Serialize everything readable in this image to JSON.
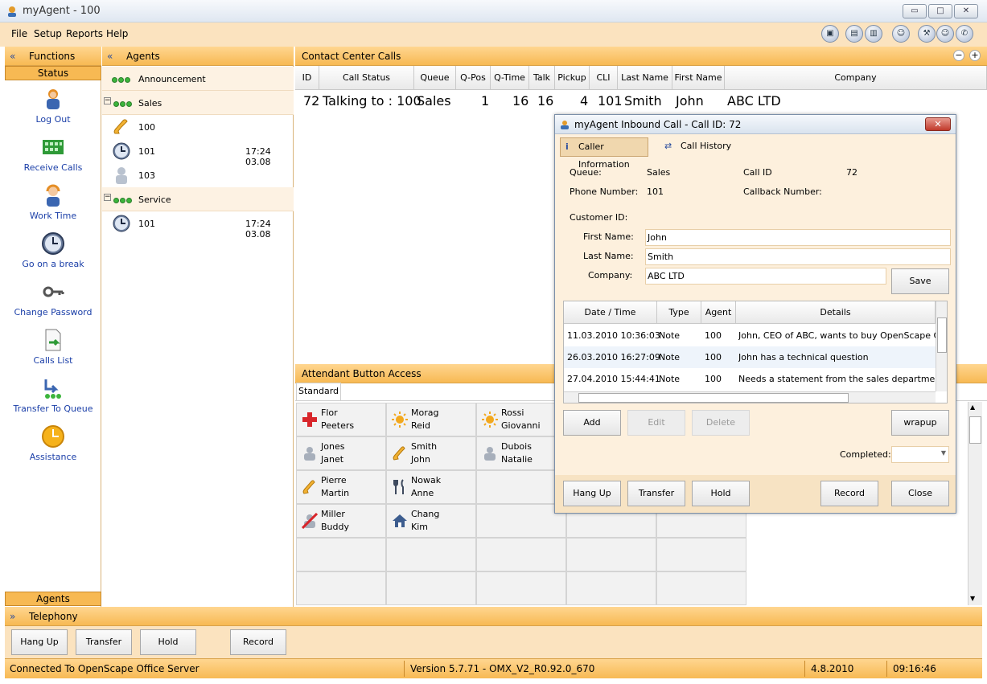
{
  "window": {
    "title": "myAgent - 100",
    "min": "▭",
    "max": "□",
    "close": "✕"
  },
  "menu": [
    "File",
    "Setup",
    "Reports",
    "Help"
  ],
  "functions": {
    "header": "Functions",
    "status_tab": "Status",
    "agents_tab": "Agents",
    "items": [
      "Log Out",
      "Receive Calls",
      "Work Time",
      "Go on a break",
      "Change Password",
      "Calls List",
      "Transfer To Queue",
      "Assistance"
    ]
  },
  "agents": {
    "header": "Agents",
    "announcement": "Announcement",
    "sales": {
      "label": "Sales",
      "rows": [
        {
          "id": "100",
          "time": ""
        },
        {
          "id": "101",
          "time": "17:24 03.08"
        },
        {
          "id": "103",
          "time": ""
        }
      ]
    },
    "service": {
      "label": "Service",
      "rows": [
        {
          "id": "101",
          "time": "17:24 03.08"
        }
      ]
    }
  },
  "calls": {
    "header": "Contact Center Calls",
    "columns": [
      "ID",
      "Call Status",
      "Queue",
      "Q-Pos",
      "Q-Time",
      "Talk",
      "Pickup",
      "CLI",
      "Last Name",
      "First Name",
      "Company"
    ],
    "row": {
      "id": "72",
      "status": "Talking to : 100",
      "queue": "Sales",
      "qpos": "1",
      "qtime": "16",
      "talk": "16",
      "pickup": "4",
      "cli": "101",
      "last": "Smith",
      "first": "John",
      "company": "ABC LTD"
    }
  },
  "attendant": {
    "header": "Attendant Button Access",
    "tab": "Standard",
    "cells": [
      {
        "first": "Flor",
        "last": "Peeters",
        "icon": "red-cross-icon"
      },
      {
        "first": "Morag",
        "last": "Reid",
        "icon": "sun-icon"
      },
      {
        "first": "Rossi",
        "last": "Giovanni",
        "icon": "sun-icon"
      },
      {
        "first": "Jones",
        "last": "Janet",
        "icon": "person-icon"
      },
      {
        "first": "Smith",
        "last": "John",
        "icon": "phone-icon"
      },
      {
        "first": "Dubois",
        "last": "Natalie",
        "icon": "person-icon"
      },
      {
        "first": "Pierre",
        "last": "Martin",
        "icon": "phone-icon"
      },
      {
        "first": "Nowak",
        "last": "Anne",
        "icon": "fork-knife-icon"
      },
      {
        "first": "Miller",
        "last": "Buddy",
        "icon": "no-entry-icon"
      },
      {
        "first": "Chang",
        "last": "Kim",
        "icon": "house-icon"
      }
    ]
  },
  "dialog": {
    "title": "myAgent Inbound Call - Call ID: 72",
    "tabs": [
      "Caller Information",
      "Call History"
    ],
    "queue_label": "Queue:",
    "queue_value": "Sales",
    "callid_label": "Call ID",
    "callid_value": "72",
    "phone_label": "Phone Number:",
    "phone_value": "101",
    "callback_label": "Callback Number:",
    "customer_label": "Customer ID:",
    "first_label": "First Name:",
    "first_value": "John",
    "last_label": "Last Name:",
    "last_value": "Smith",
    "company_label": "Company:",
    "company_value": "ABC LTD",
    "save": "Save",
    "history_cols": [
      "Date / Time",
      "Type",
      "Agent",
      "Details"
    ],
    "history": [
      {
        "dt": "11.03.2010 10:36:03",
        "type": "Note",
        "agent": "100",
        "details": "John, CEO of ABC, wants to buy OpenScape Office"
      },
      {
        "dt": "26.03.2010 16:27:09",
        "type": "Note",
        "agent": "100",
        "details": "John has a technical question"
      },
      {
        "dt": "27.04.2010 15:44:41",
        "type": "Note",
        "agent": "100",
        "details": "Needs a statement from the sales department"
      }
    ],
    "add": "Add",
    "edit": "Edit",
    "delete": "Delete",
    "wrapup": "wrapup",
    "completed_label": "Completed:",
    "hangup": "Hang Up",
    "transfer": "Transfer",
    "hold": "Hold",
    "record": "Record",
    "close": "Close"
  },
  "telephony": {
    "header": "Telephony",
    "hangup": "Hang Up",
    "transfer": "Transfer",
    "hold": "Hold",
    "record": "Record"
  },
  "statusbar": {
    "connection": "Connected To OpenScape Office Server",
    "version": "Version 5.7.71 - OMX_V2_R0.92.0_670",
    "date": "4.8.2010",
    "time": "09:16:46"
  }
}
